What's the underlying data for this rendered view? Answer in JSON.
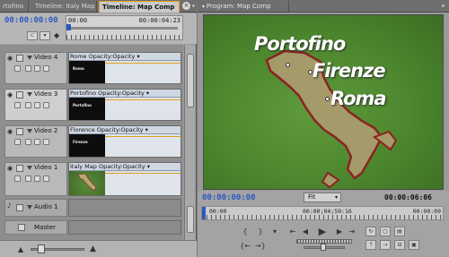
{
  "colors": {
    "timecode": "#2b59c3",
    "active_tab_border": "#e8a020",
    "video_green": "#4f8a30",
    "italy_fill": "#a59a6a",
    "italy_outline": "#8a2420"
  },
  "timeline_tabs": [
    {
      "label": "rtofino"
    },
    {
      "label": "Timeline: Italy Map"
    },
    {
      "label": "Timeline: Map Comp",
      "active": true
    }
  ],
  "timeline": {
    "timecode": "00:00:00:00",
    "ruler_start": "00:00",
    "ruler_end": "00:00:04:23",
    "tracks": [
      {
        "name": "Video 4",
        "clip": "Rome  Opacity:Opacity ▾",
        "thumb_text": "Roma",
        "thumb": "black",
        "selected": false
      },
      {
        "name": "Video 3",
        "clip": "Portofino  Opacity:Opacity ▾",
        "thumb_text": "Portofino",
        "thumb": "black",
        "selected": true
      },
      {
        "name": "Video 2",
        "clip": "Florence  Opacity:Opacity ▾",
        "thumb_text": "Firenze",
        "thumb": "black",
        "selected": false
      },
      {
        "name": "Video 1",
        "clip": "Italy Map  Opacity:Opacity ▾",
        "thumb_text": "",
        "thumb": "map",
        "selected": false
      }
    ],
    "audio_tracks": [
      {
        "name": "Audio 1"
      },
      {
        "name": "Master"
      }
    ]
  },
  "program": {
    "tab_label": "Program: Map Comp",
    "cities": {
      "portofino": "Portofino",
      "firenze": "Firenze",
      "roma": "Roma"
    },
    "current_timecode": "00:00:00:00",
    "fit_label": "Fit",
    "duration": "00:00:06:06",
    "ruler_start": "00:00",
    "ruler_mid": "00:00;04;59:16",
    "ruler_end": "00:00:09"
  },
  "icons": [
    "eye-icon",
    "speaker-icon",
    "play-icon",
    "step-back-icon",
    "step-forward-icon",
    "loop-icon",
    "marker-icon",
    "export-frame-icon",
    "panel-menu-icon",
    "close-icon"
  ]
}
